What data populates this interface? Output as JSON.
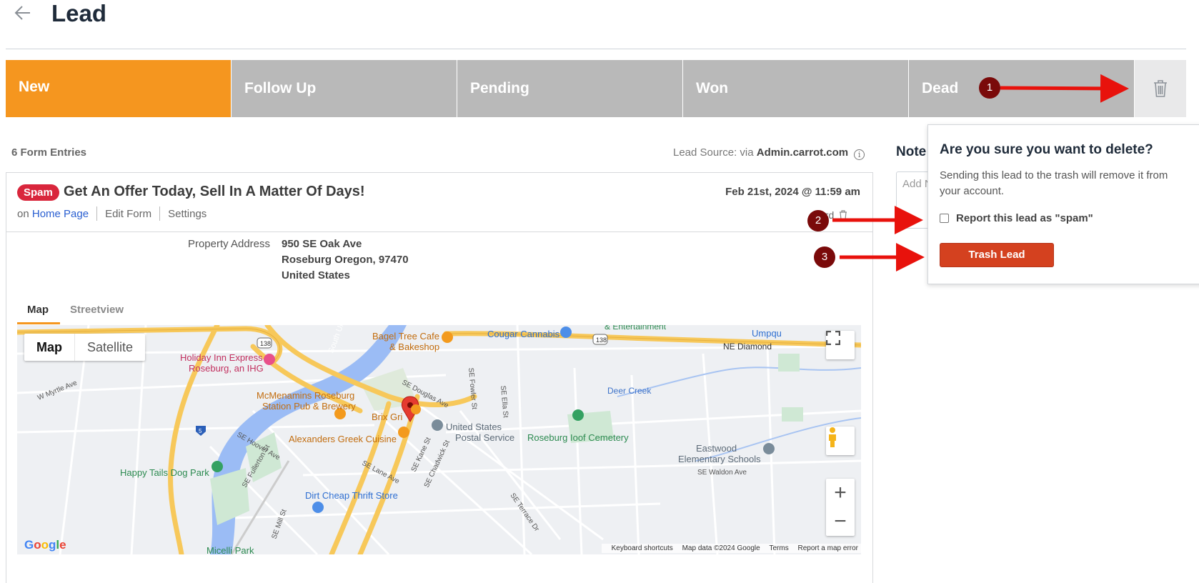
{
  "header": {
    "title": "Lead",
    "back_icon": "arrow-left-icon"
  },
  "stages": [
    {
      "label": "New",
      "active": true
    },
    {
      "label": "Follow Up",
      "active": false
    },
    {
      "label": "Pending",
      "active": false
    },
    {
      "label": "Won",
      "active": false
    },
    {
      "label": "Dead",
      "active": false
    }
  ],
  "stage_trash_icon": "trash-icon",
  "info": {
    "entries_count": "6 Form Entries",
    "lead_source_prefix": "Lead Source: via",
    "lead_source_value": "Admin.carrot.com",
    "info_icon": "info-icon"
  },
  "entry": {
    "badge": "Spam",
    "title": "Get An Offer Today, Sell In A Matter Of Days!",
    "date": "Feb 21st, 2024 @ 11:59 am",
    "on_label": "on",
    "page_link": "Home Page",
    "edit_form": "Edit Form",
    "settings": "Settings",
    "discard_partial": "card",
    "property_label": "Property Address",
    "address_line1": "950 SE Oak Ave",
    "address_line2": "Roseburg Oregon, 97470",
    "address_line3": "United States"
  },
  "map_tabs": {
    "map": "Map",
    "streetview": "Streetview"
  },
  "map": {
    "type_map": "Map",
    "type_satellite": "Satellite",
    "zoom_in": "+",
    "zoom_out": "−",
    "logo": "Google",
    "footer": {
      "shortcuts": "Keyboard shortcuts",
      "data": "Map data ©2024 Google",
      "terms": "Terms",
      "report": "Report a map error"
    },
    "labels": {
      "bagel1": "Bagel Tree Cafe",
      "bagel2": "& Bakeshop",
      "cougar": "Cougar Cannabis",
      "holiday1": "Holiday Inn Express",
      "holiday2": "Roseburg, an IHG",
      "mcmen1": "McMenamins Roseburg",
      "mcmen2": "Station Pub & Brewery",
      "brix": "Brix Gri",
      "usps1": "United States",
      "usps2": "Postal Service",
      "alexanders": "Alexanders Greek Cuisine",
      "cemetery": "Roseburg Ioof Cemetery",
      "deer": "Deer Creek",
      "eastwood1": "Eastwood",
      "eastwood2": "Elementary Schools",
      "happy": "Happy Tails Dog Park",
      "thrift": "Dirt Cheap Thrift Store",
      "micelli": "Micelli Park",
      "entertainment": "& Entertainment",
      "umpqua": "Umpqu",
      "ne_diamond": "NE Diamond",
      "south_u": "South Um",
      "douglas": "SE Douglas Ave",
      "fowler": "SE Fowler St",
      "ella": "SE Ella St",
      "hoover": "SE Hoover Ave",
      "fullerton": "SE Fullerton St",
      "lane": "SE Lane Ave",
      "kane": "SE Kane St",
      "chadwick": "SE Chadwick St",
      "waldon": "SE Waldon Ave",
      "myrtle": "W Myrtle Ave",
      "terrace": "SE Terrace Dr",
      "mill": "SE Mill St",
      "r138a": "138",
      "r138b": "138",
      "i5": "5"
    }
  },
  "notes": {
    "title": "Note",
    "placeholder": "Add N"
  },
  "popover": {
    "title": "Are you sure you want to delete?",
    "body": "Sending this lead to the trash will remove it from your account.",
    "checkbox_label": "Report this lead as \"spam\"",
    "button": "Trash Lead"
  },
  "annotations": [
    {
      "label": "1"
    },
    {
      "label": "2"
    },
    {
      "label": "3"
    }
  ],
  "colors": {
    "active_stage": "#f5961f",
    "inactive_stage": "#b9b9b9",
    "spam_badge": "#d9263c",
    "trash_button": "#d4411f",
    "marker": "#7a0a0a",
    "arrow": "#e8120c",
    "link": "#2a5fd1"
  }
}
